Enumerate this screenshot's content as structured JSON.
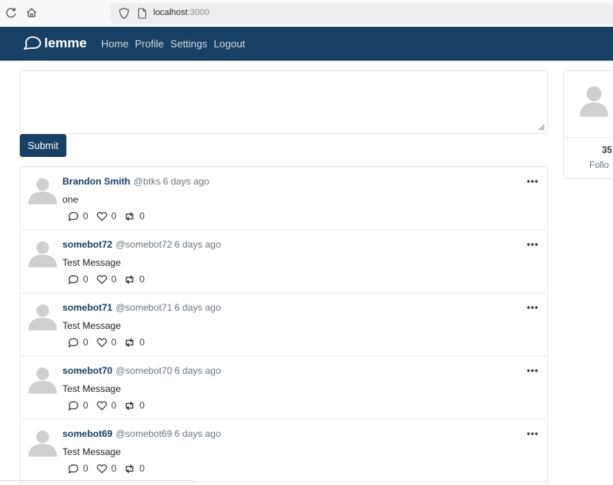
{
  "browser": {
    "url_host": "localhost",
    "url_port": ":3000"
  },
  "navbar": {
    "brand": "lemme",
    "links": [
      {
        "label": "Home"
      },
      {
        "label": "Profile"
      },
      {
        "label": "Settings"
      },
      {
        "label": "Logout"
      }
    ]
  },
  "composer": {
    "text": "",
    "submit_label": "Submit"
  },
  "posts": [
    {
      "name": "Brandon Smith",
      "handle": "@btks",
      "time": "6 days ago",
      "text": "one",
      "replies": "0",
      "likes": "0",
      "reposts": "0"
    },
    {
      "name": "somebot72",
      "handle": "@somebot72",
      "time": "6 days ago",
      "text": "Test Message",
      "replies": "0",
      "likes": "0",
      "reposts": "0"
    },
    {
      "name": "somebot71",
      "handle": "@somebot71",
      "time": "6 days ago",
      "text": "Test Message",
      "replies": "0",
      "likes": "0",
      "reposts": "0"
    },
    {
      "name": "somebot70",
      "handle": "@somebot70",
      "time": "6 days ago",
      "text": "Test Message",
      "replies": "0",
      "likes": "0",
      "reposts": "0"
    },
    {
      "name": "somebot69",
      "handle": "@somebot69",
      "time": "6 days ago",
      "text": "Test Message",
      "replies": "0",
      "likes": "0",
      "reposts": "0"
    }
  ],
  "profile_card": {
    "stat_value": "35",
    "stat_label": "Follo"
  },
  "colors": {
    "navbar_bg": "#183f64",
    "accent": "#183f64"
  }
}
